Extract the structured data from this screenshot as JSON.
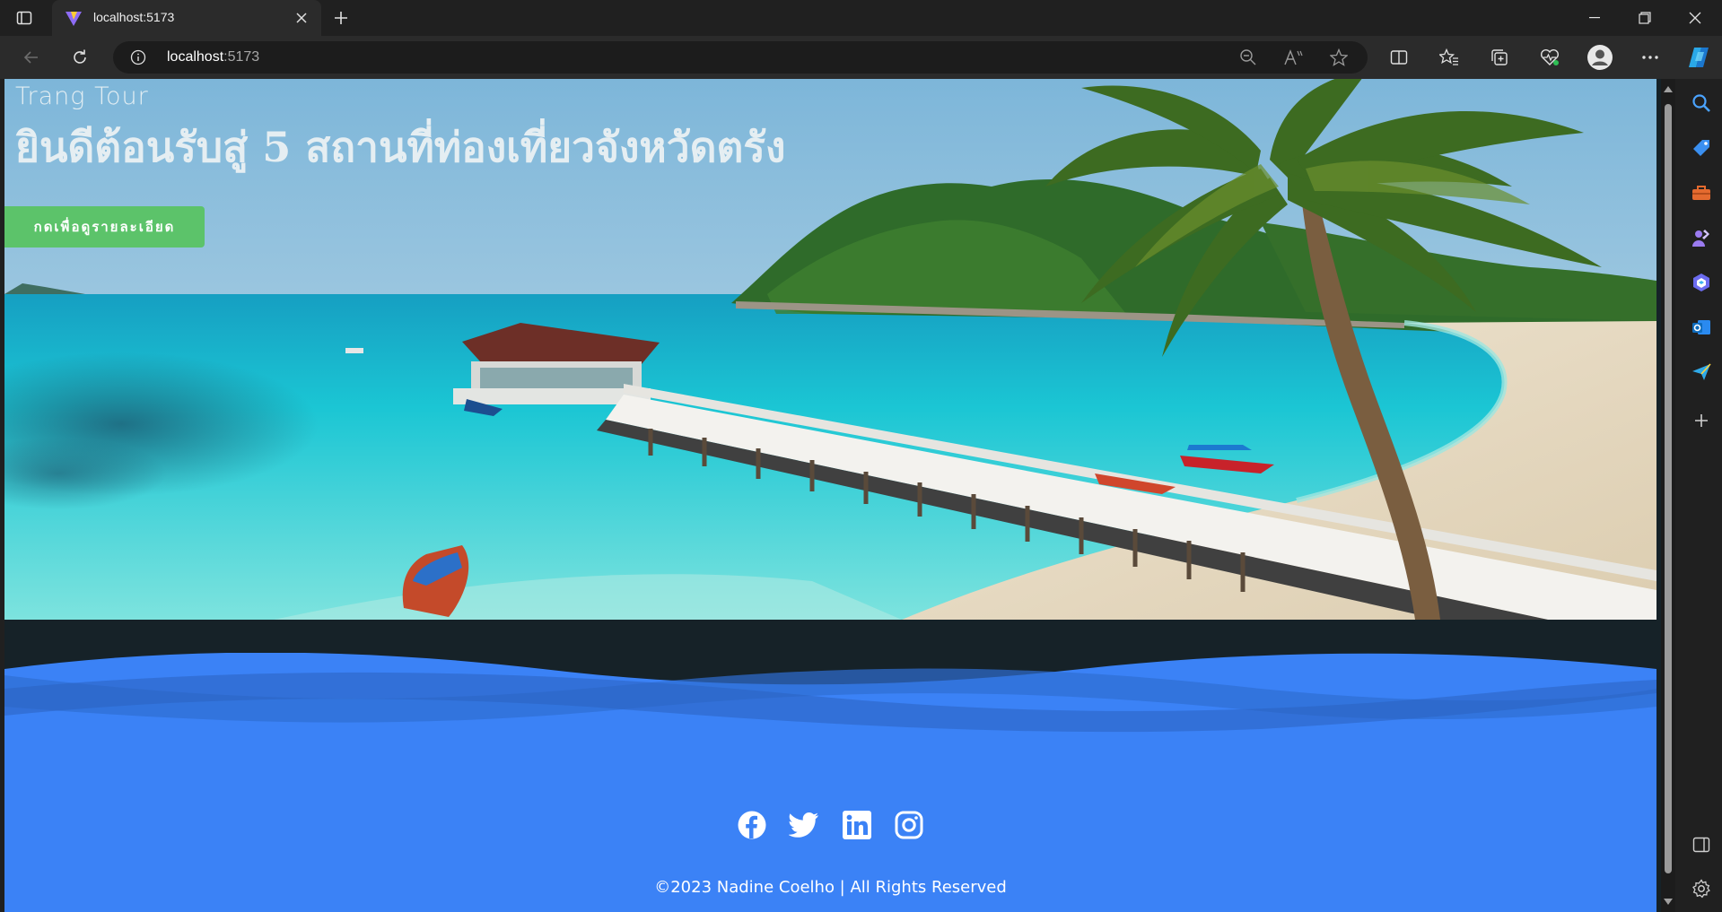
{
  "browser": {
    "tab_title": "localhost:5173",
    "address_host": "localhost",
    "address_port": ":5173",
    "icons": [
      "tab-actions-icon",
      "vite-favicon",
      "close-icon",
      "plus-icon",
      "minimize-icon",
      "restore-icon",
      "close-window-icon",
      "back-icon",
      "refresh-icon",
      "info-icon",
      "zoom-out-icon",
      "read-aloud-icon",
      "favorite-star-icon",
      "split-screen-icon",
      "favorites-icon",
      "collections-icon",
      "performance-icon",
      "profile-icon",
      "more-icon",
      "copilot-icon"
    ]
  },
  "sidebar": {
    "icons": [
      "search-icon",
      "shopping-tag-icon",
      "tools-icon",
      "games-icon",
      "office-icon",
      "outlook-icon",
      "send-icon",
      "add-icon",
      "sidebar-toggle-icon",
      "settings-icon"
    ]
  },
  "hero": {
    "brand": "Trang Tour",
    "title": "ยินดีต้อนรับสู่ 5 สถานที่ท่องเที่ยวจังหวัดตรัง",
    "button_label": "กดเพื่อดูรายละเอียด"
  },
  "footer": {
    "social_icons": [
      "facebook-icon",
      "twitter-icon",
      "linkedin-icon",
      "instagram-icon"
    ],
    "copyright": "©2023 Nadine Coelho | All Rights Reserved"
  },
  "colors": {
    "footer_blue": "#3b82f6",
    "button_green": "#5cc36a",
    "dark_band": "#162228"
  }
}
